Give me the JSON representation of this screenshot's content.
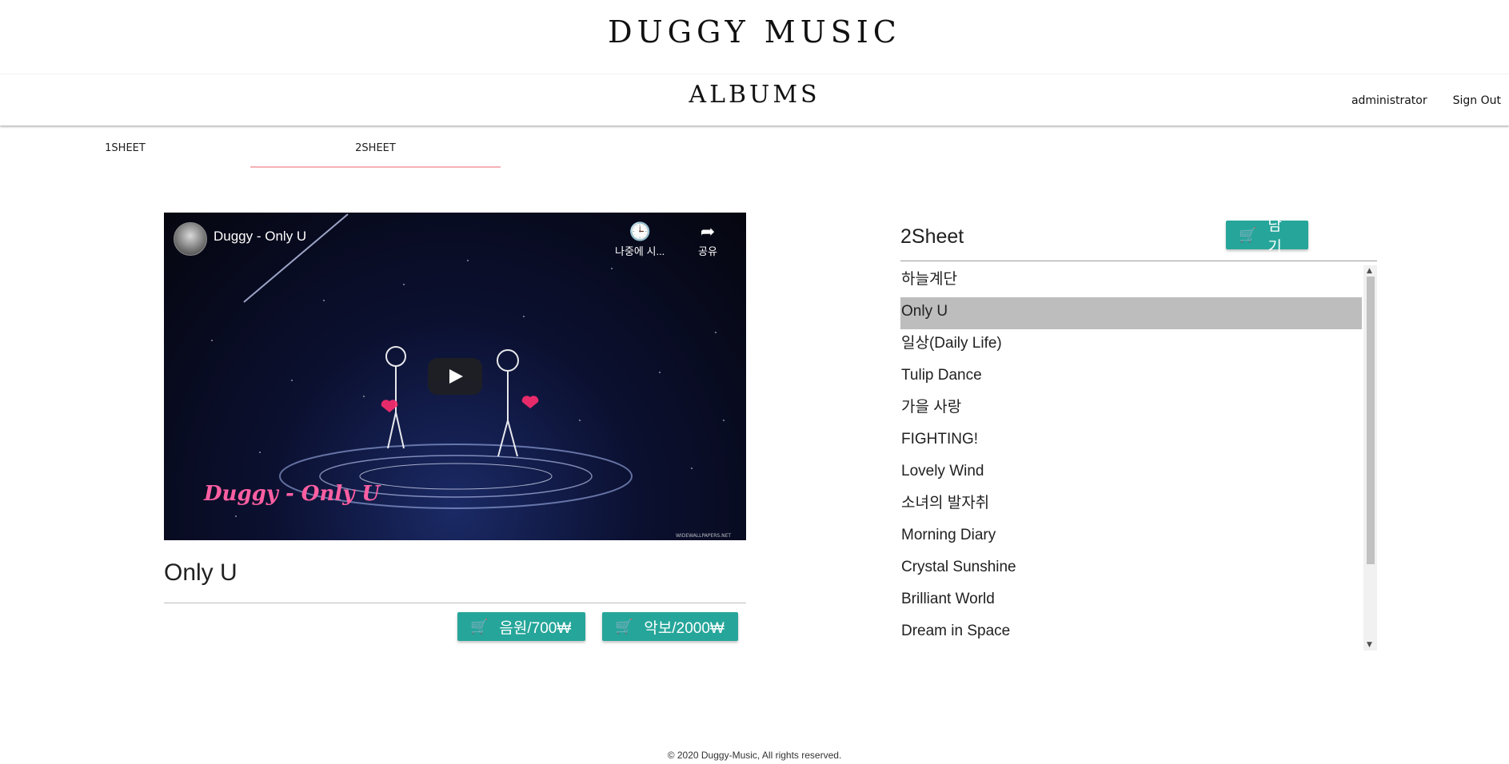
{
  "header": {
    "brand": "DUGGY MUSIC",
    "section_title": "ALBUMS"
  },
  "nav": {
    "user": "administrator",
    "sign_out": "Sign Out"
  },
  "tabs": [
    {
      "label": "1Sheet",
      "active": false
    },
    {
      "label": "2Sheet",
      "active": true
    }
  ],
  "player": {
    "channel_title": "Duggy - Only U",
    "watch_later": "나중에 시...",
    "share": "공유",
    "overlay_text": "Duggy - Only U",
    "watermark": "WIDEWALLPAPERS.NET"
  },
  "song": {
    "title": "Only U",
    "buy_audio": "음원/700₩",
    "buy_sheet": "악보/2000₩"
  },
  "sheet_panel": {
    "name": "2Sheet",
    "add_button": "담기",
    "songs": [
      "하늘계단",
      "Only U",
      "일상(Daily Life)",
      "Tulip Dance",
      "가을 사랑",
      "FIGHTING!",
      "Lovely Wind",
      "소녀의 발자취",
      "Morning Diary",
      "Crystal Sunshine",
      "Brilliant World",
      "Dream in Space"
    ],
    "selected_index": 1
  },
  "footer": {
    "copyright": "© 2020 Duggy-Music, All rights reserved."
  },
  "colors": {
    "accent": "#26a69a",
    "tab_indicator": "#f6b2b5",
    "selected_row": "#bdbdbd"
  },
  "icons": {
    "cart": "shopping-cart-icon",
    "clock": "clock-icon",
    "share": "share-icon",
    "play": "play-icon"
  }
}
